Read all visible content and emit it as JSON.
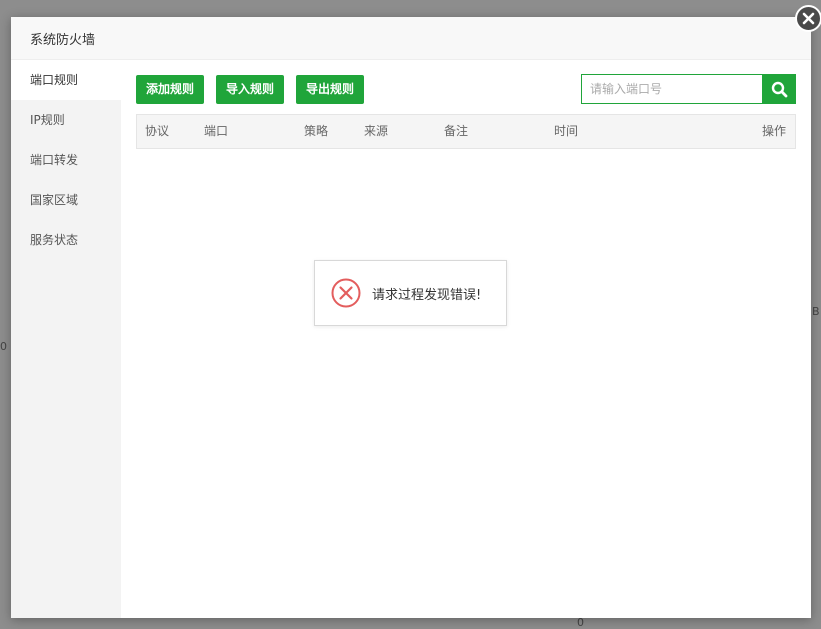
{
  "modal": {
    "title": "系统防火墙"
  },
  "sidebar": {
    "items": [
      {
        "label": "端口规则",
        "active": true
      },
      {
        "label": "IP规则"
      },
      {
        "label": "端口转发"
      },
      {
        "label": "国家区域"
      },
      {
        "label": "服务状态"
      }
    ]
  },
  "toolbar": {
    "add_label": "添加规则",
    "import_label": "导入规则",
    "export_label": "导出规则"
  },
  "search": {
    "placeholder": "请输入端口号",
    "value": ""
  },
  "table": {
    "columns": [
      "协议",
      "端口",
      "策略",
      "来源",
      "备注",
      "时间",
      "操作"
    ]
  },
  "error": {
    "message": "请求过程发现错误!"
  },
  "icons": {
    "close": "close-icon",
    "search": "search-icon",
    "error": "error-circle-icon"
  },
  "colors": {
    "accent": "#20a53a",
    "error": "#e35d5d"
  },
  "background": {
    "fragments": [
      "0",
      "0",
      "B"
    ]
  }
}
